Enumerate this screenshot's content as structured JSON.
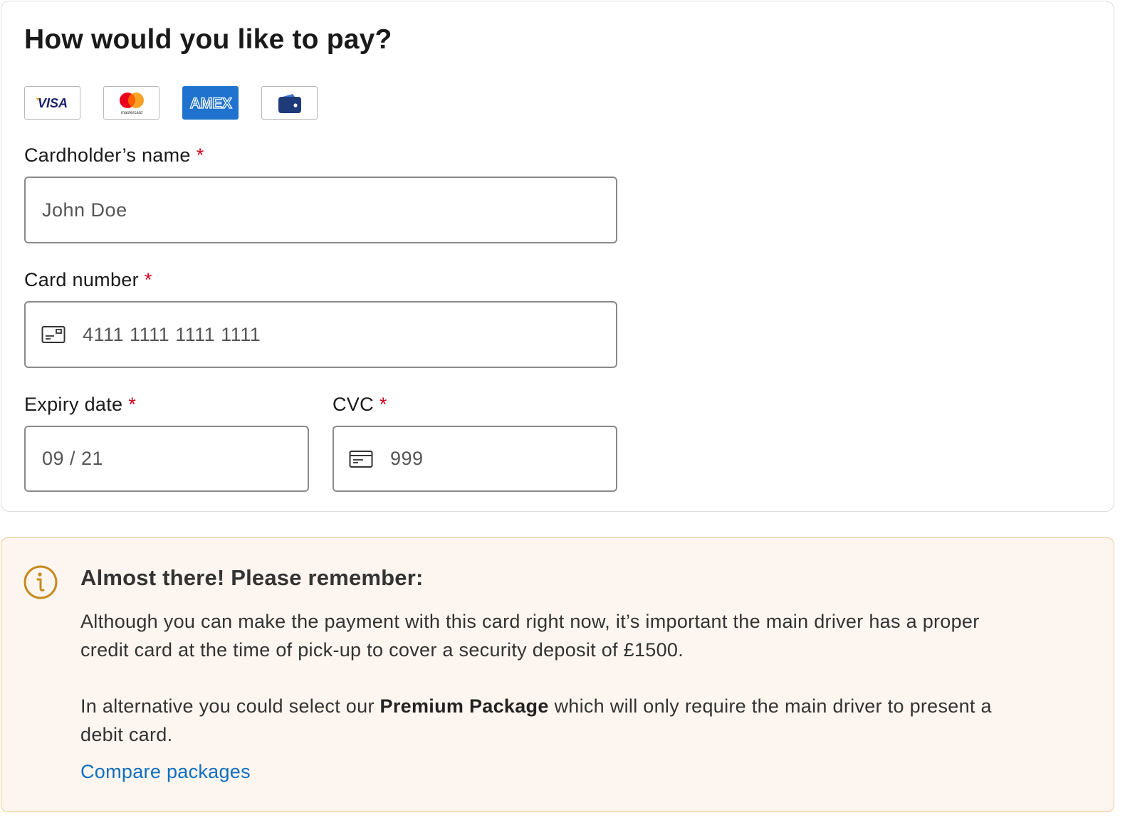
{
  "payment": {
    "title": "How would you like to pay?",
    "logos": [
      {
        "name": "visa",
        "text": "VISA"
      },
      {
        "name": "mastercard",
        "text": "mastercard"
      },
      {
        "name": "amex",
        "text": "AMEX"
      },
      {
        "name": "wallet",
        "icon": "wallet-icon"
      }
    ],
    "cardholder": {
      "label": "Cardholder’s name",
      "required_mark": "*",
      "placeholder": "John Doe"
    },
    "card_number": {
      "label": "Card number",
      "required_mark": "*",
      "placeholder": "4111 1111 1111 1111",
      "icon": "credit-card-icon"
    },
    "expiry": {
      "label": "Expiry date",
      "required_mark": "*",
      "placeholder": "09 / 21"
    },
    "cvc": {
      "label": "CVC",
      "required_mark": "*",
      "placeholder": "999",
      "icon": "card-back-icon"
    }
  },
  "notice": {
    "icon": "info-icon",
    "title": "Almost there! Please remember:",
    "paragraph1": "Although you can make the payment with this card right now, it’s important the main driver has a proper credit card at the time of pick-up to cover a security deposit of £1500.",
    "paragraph2_prefix": "In alternative you could select our ",
    "paragraph2_bold": "Premium Package",
    "paragraph2_suffix": " which will only require the main driver to present a debit card.",
    "link": "Compare packages"
  },
  "colors": {
    "required": "#d0021b",
    "link": "#0f6fbd",
    "notice_bg": "#fdf5ef",
    "notice_border": "#f3c892",
    "info_icon": "#c68a1d",
    "amex_blue": "#1f72cd"
  }
}
